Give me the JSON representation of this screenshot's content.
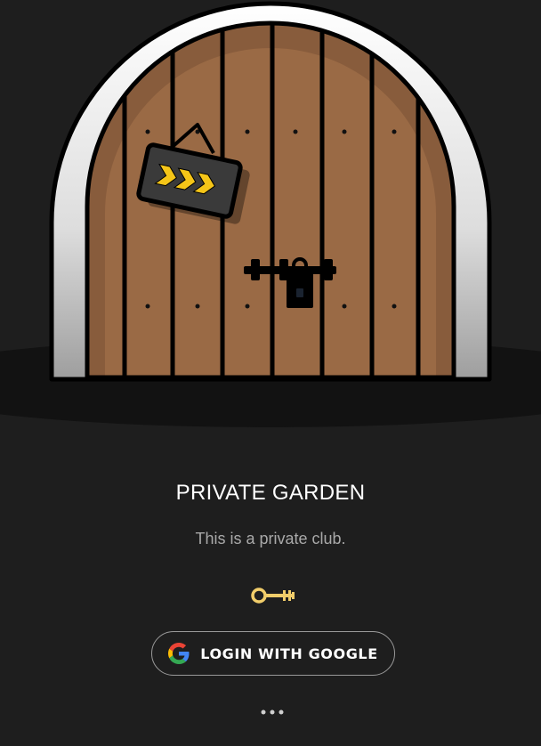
{
  "page": {
    "title": "PRIVATE GARDEN",
    "subtitle": "This is a private club."
  },
  "illustration": {
    "icon": "arched-wooden-door",
    "sign_icon": "chevron-arrows-icon",
    "lock_icon": "padlock-icon"
  },
  "key": {
    "icon": "key-icon",
    "color": "#f1cd6a"
  },
  "login": {
    "label": "LOGIN WITH GOOGLE",
    "icon": "google-icon"
  },
  "more": {
    "icon": "more-dots-icon"
  },
  "colors": {
    "background": "#1e1e1e",
    "door_wood": "#9a6a45",
    "door_frame": "#e6e6e6",
    "sign_chevrons": "#f5c518"
  }
}
